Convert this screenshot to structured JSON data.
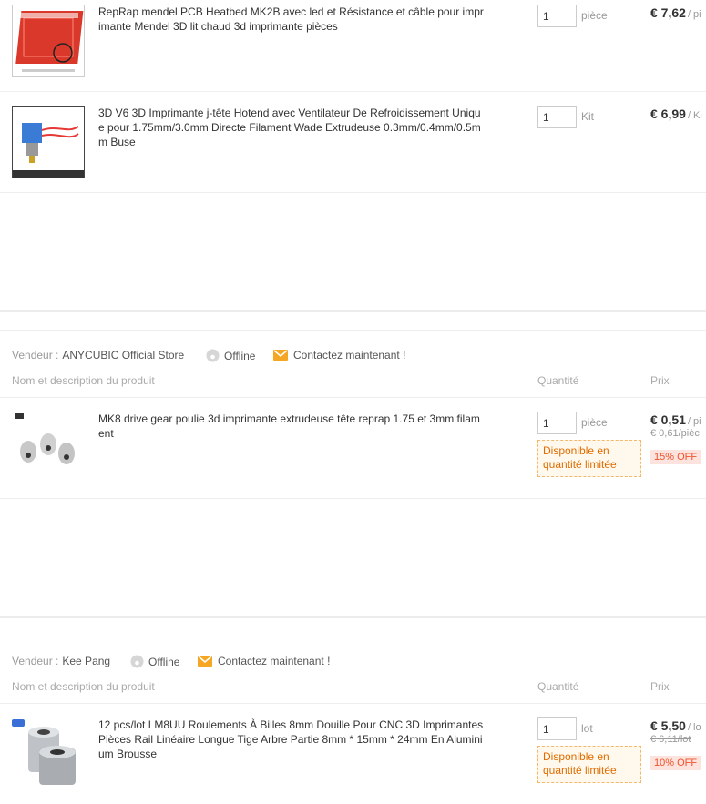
{
  "items_top": [
    {
      "title": "RepRap mendel PCB Heatbed MK2B avec led et Résistance et câble pour imprimante Mendel 3D lit chaud 3d imprimante pièces",
      "qty": "1",
      "unit": "pièce",
      "price": "€ 7,62",
      "per": "/ pi"
    },
    {
      "title": "3D V6 3D Imprimante j-tête Hotend avec Ventilateur De Refroidissement Unique pour 1.75mm/3.0mm Directe Filament Wade Extrudeuse 0.3mm/0.4mm/0.5mm Buse",
      "qty": "1",
      "unit": "Kit",
      "price": "€ 6,99",
      "per": "/ Ki"
    }
  ],
  "store1": {
    "vendor_label": "Vendeur :",
    "vendor_name": "ANYCUBIC Official Store",
    "status": "Offline",
    "contact": "Contactez maintenant !",
    "col_product": "Nom et description du produit",
    "col_qty": "Quantité",
    "col_price": "Prix",
    "item": {
      "title": "MK8 drive gear poulie 3d imprimante extrudeuse tête reprap 1.75 et 3mm filament",
      "qty": "1",
      "unit": "pièce",
      "avail": "Disponible en quantité limitée",
      "price": "€ 0,51",
      "per": "/ pi",
      "orig": "€ 0,61/pièc",
      "discount": "15% OFF"
    }
  },
  "store2": {
    "vendor_label": "Vendeur :",
    "vendor_name": "Kee Pang",
    "status": "Offline",
    "contact": "Contactez maintenant !",
    "col_product": "Nom et description du produit",
    "col_qty": "Quantité",
    "col_price": "Prix",
    "item": {
      "title": "12 pcs/lot LM8UU Roulements À Billes 8mm Douille Pour CNC 3D Imprimantes Pièces Rail Linéaire Longue Tige Arbre Partie 8mm * 15mm * 24mm En Aluminium Brousse",
      "qty": "1",
      "unit": "lot",
      "avail": "Disponible en quantité limitée",
      "price": "€ 5,50",
      "per": "/ lo",
      "orig": "€ 6,11/lot",
      "discount": "10% OFF"
    }
  },
  "icons": {
    "status": "offline-status-icon",
    "contact": "envelope-icon"
  },
  "colors": {
    "accent_orange": "#e06c00",
    "discount_red": "#f0522c",
    "envelope": "#f5a623"
  }
}
